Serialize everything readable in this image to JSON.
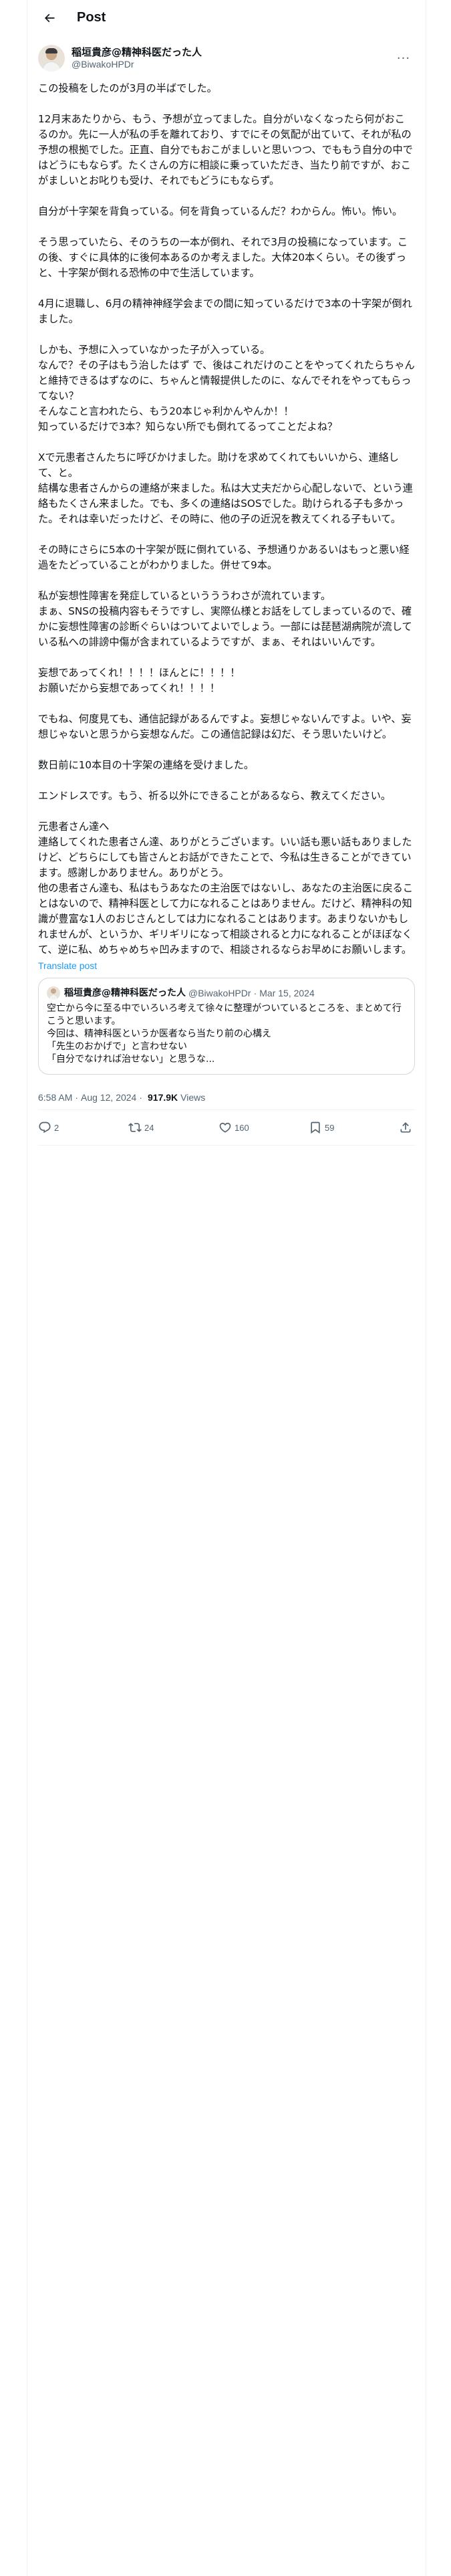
{
  "header": {
    "title": "Post"
  },
  "author": {
    "name": "稲垣貴彦@精神科医だった人",
    "handle": "@BiwakoHPDr",
    "more": "···"
  },
  "post": {
    "text": "この投稿をしたのが3月の半ばでした。\n\n12月末あたりから、もう、予想が立ってました。自分がいなくなったら何がおこるのか。先に一人が私の手を離れており、すでにその気配が出ていて、それが私の予想の根拠でした。正直、自分でもおこがましいと思いつつ、でももう自分の中ではどうにもならず。たくさんの方に相談に乗っていただき、当たり前ですが、おこがましいとお叱りも受け、それでもどうにもならず。\n\n自分が十字架を背負っている。何を背負っているんだ？わからん。怖い。怖い。\n\nそう思っていたら、そのうちの一本が倒れ、それで3月の投稿になっています。この後、すぐに具体的に後何本あるのか考えました。大体20本くらい。その後ずっと、十字架が倒れる恐怖の中で生活しています。\n\n4月に退職し、6月の精神神経学会までの間に知っているだけで3本の十字架が倒れました。\n\nしかも、予想に入っていなかった子が入っている。\nなんで？その子はもう治したはず で、後はこれだけのことをやってくれたらちゃんと維持できるはずなのに、ちゃんと情報提供したのに、なんでそれをやってもらってない？\nそんなこと言われたら、もう20本じゃ利かんやんか！！\n知っているだけで3本？知らない所でも倒れてるってことだよね？\n\nXで元患者さんたちに呼びかけました。助けを求めてくれてもいいから、連絡して、と。\n結構な患者さんからの連絡が来ました。私は大丈夫だから心配しないで、という連絡もたくさん来ました。でも、多くの連絡はSOSでした。助けられる子も多かった。それは幸いだったけど、その時に、他の子の近況を教えてくれる子もいて。\n\nその時にさらに5本の十字架が既に倒れている、予想通りかあるいはもっと悪い経過をたどっていることがわかりました。併せて9本。\n\n私が妄想性障害を発症しているというううわさが流れています。\nまぁ、SNSの投稿内容もそうですし、実際仏様とお話をしてしまっているので、確かに妄想性障害の診断ぐらいはついてよいでしょう。一部には琵琶湖病院が流している私への誹謗中傷が含まれているようですが、まぁ、それはいいんです。\n\n妄想であってくれ！！！！ほんとに！！！！\nお願いだから妄想であってくれ！！！！\n\nでもね、何度見ても、通信記録があるんですよ。妄想じゃないんですよ。いや、妄想じゃないと思うから妄想なんだ。この通信記録は幻だ、そう思いたいけど。\n\n数日前に10本目の十字架の連絡を受けました。\n\nエンドレスです。もう、祈る以外にできることがあるなら、教えてください。\n\n元患者さん達へ\n連絡してくれた患者さん達、ありがとうございます。いい話も悪い話もありましたけど、どちらにしても皆さんとお話ができたことで、今私は生きることができています。感謝しかありません。ありがとう。\n他の患者さん達も、私はもうあなたの主治医ではないし、あなたの主治医に戻ることはないので、精神科医として力になれることはありません。だけど、精神科の知識が豊富な1人のおじさんとしては力になれることはあります。あまりないかもしれませんが、というか、ギリギリになって相談されると力になれることがほぼなくて、逆に私、めちゃめちゃ凹みますので、相談されるならお早めにお願いします。",
    "translate": "Translate post"
  },
  "quote": {
    "name": "稲垣貴彦@精神科医だった人",
    "handle": "@BiwakoHPDr",
    "date": "Mar 15, 2024",
    "text": "空亡から今に至る中でいろいろ考えて徐々に整理がついているところを、まとめて行こうと思います。\n今回は、精神科医というか医者なら当たり前の心構え\n「先生のおかげで」と言わせない\n「自分でなければ治せない」と思うな..."
  },
  "meta": {
    "time": "6:58 AM",
    "date": "Aug 12, 2024",
    "views": "917.9K",
    "views_label": "Views"
  },
  "actions": {
    "replies": "2",
    "reposts": "24",
    "likes": "160",
    "bookmarks": "59"
  },
  "colors": {
    "accent": "#1d9bf0",
    "text": "#0f1419",
    "muted": "#536471",
    "border": "#eff3f4"
  }
}
